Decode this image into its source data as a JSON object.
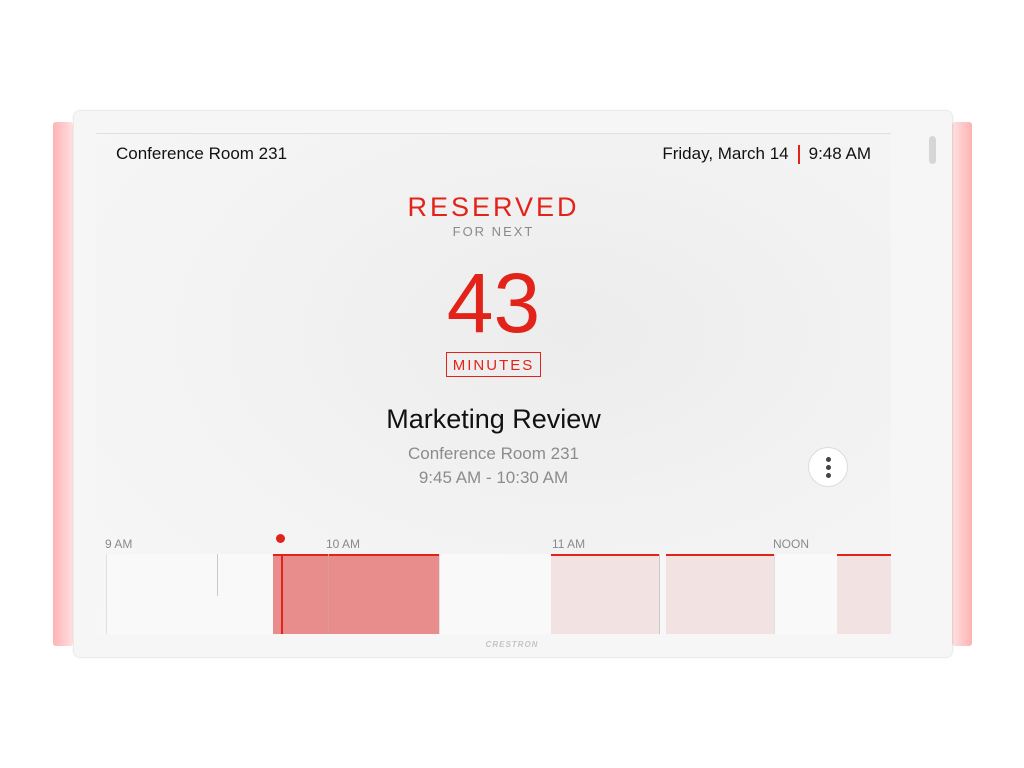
{
  "header": {
    "room_name": "Conference Room 231",
    "date": "Friday, March 14",
    "time": "9:48 AM"
  },
  "status": {
    "label": "RESERVED",
    "sublabel": "FOR NEXT",
    "count": "43",
    "unit": "MINUTES"
  },
  "meeting": {
    "title": "Marketing Review",
    "room": "Conference Room 231",
    "time_range": "9:45 AM - 10:30 AM"
  },
  "timeline": {
    "labels": [
      "9 AM",
      "10 AM",
      "11 AM",
      "NOON"
    ]
  },
  "brand": "CRESTRON",
  "colors": {
    "accent": "#e2231a",
    "current_block": "#e88c8c",
    "future_block": "#f3e2e2",
    "led": "#ffb3b3"
  },
  "icons": {
    "menu": "more-vertical-icon"
  }
}
